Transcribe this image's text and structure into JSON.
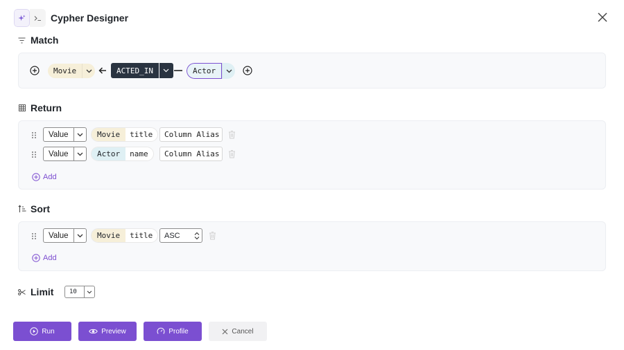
{
  "header": {
    "title": "Cypher Designer",
    "mode_icons": [
      "sparkle-icon",
      "terminal-icon"
    ],
    "close_icon": "close-icon"
  },
  "match": {
    "title": "Match",
    "source_node": "Movie",
    "relationship": "ACTED_IN",
    "direction": "incoming",
    "target_node": "Actor"
  },
  "return": {
    "title": "Return",
    "rows": [
      {
        "type": "Value",
        "node": "Movie",
        "property": "title",
        "alias_placeholder": "Column Alias"
      },
      {
        "type": "Value",
        "node": "Actor",
        "property": "name",
        "alias_placeholder": "Column Alias"
      }
    ],
    "add_label": "Add"
  },
  "sort": {
    "title": "Sort",
    "rows": [
      {
        "type": "Value",
        "node": "Movie",
        "property": "title",
        "order": "ASC"
      }
    ],
    "add_label": "Add"
  },
  "limit": {
    "title": "Limit",
    "value": "10"
  },
  "actions": {
    "run": "Run",
    "preview": "Preview",
    "profile": "Profile",
    "cancel": "Cancel"
  },
  "colors": {
    "accent": "#7b4fd1",
    "movie_node": "#f6efd9",
    "actor_node": "#dff0f4",
    "relationship": "#2a3441"
  }
}
